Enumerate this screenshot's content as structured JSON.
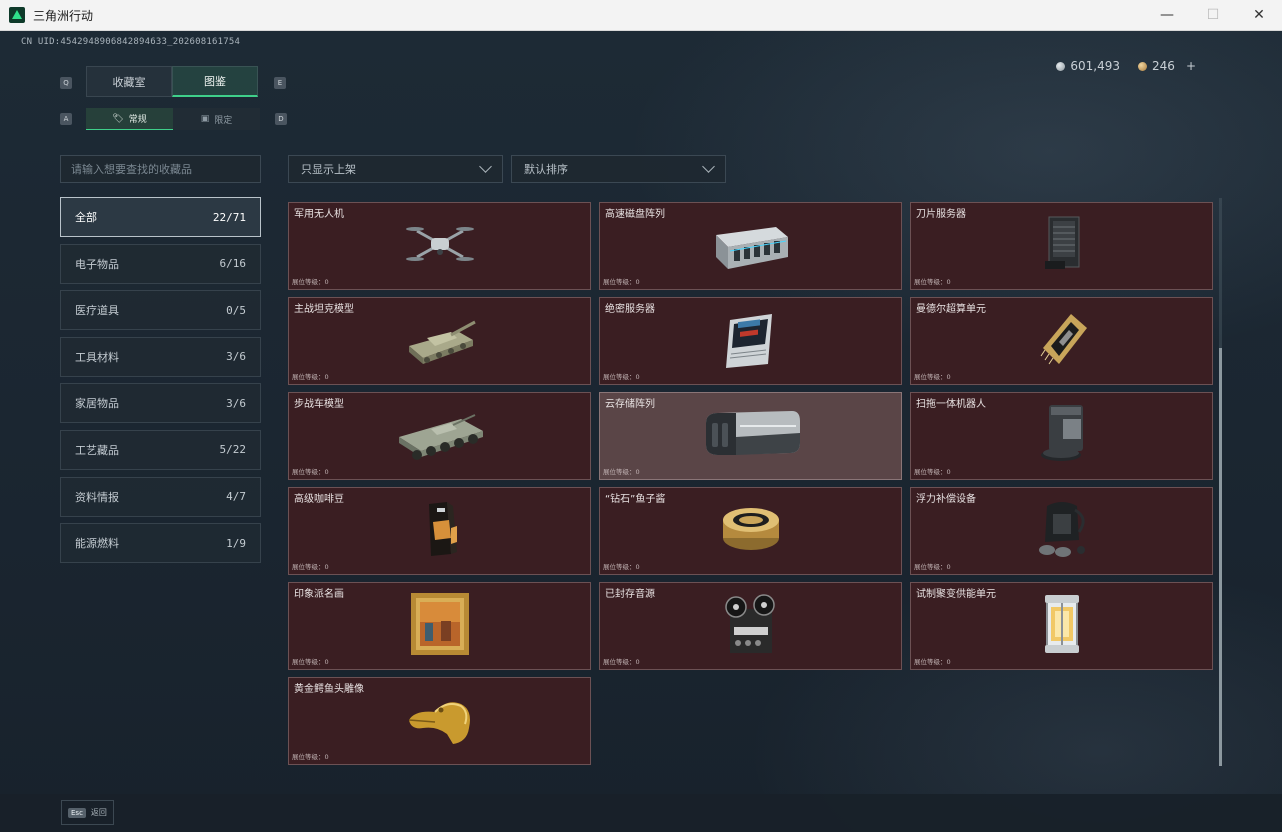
{
  "window": {
    "title": "三角洲行动",
    "minimize": "—",
    "maximize": "☐",
    "close": "✕"
  },
  "uid": "CN UID:4542948906842894633_202608161754",
  "currency": {
    "silver": "601,493",
    "gold": "246",
    "add": "+"
  },
  "keys": {
    "left": "Q",
    "right": "E",
    "sub_left": "A",
    "sub_right": "D"
  },
  "tabs": [
    "收藏室",
    "图鉴"
  ],
  "subtabs": [
    "常规",
    "限定"
  ],
  "search": {
    "placeholder": "请输入想要查找的收藏品"
  },
  "categories": [
    {
      "label": "全部",
      "count": "22/71"
    },
    {
      "label": "电子物品",
      "count": "6/16"
    },
    {
      "label": "医疗道具",
      "count": "0/5"
    },
    {
      "label": "工具材料",
      "count": "3/6"
    },
    {
      "label": "家居物品",
      "count": "3/6"
    },
    {
      "label": "工艺藏品",
      "count": "5/22"
    },
    {
      "label": "资料情报",
      "count": "4/7"
    },
    {
      "label": "能源燃料",
      "count": "1/9"
    }
  ],
  "filters": {
    "shelf": "只显示上架",
    "sort": "默认排序"
  },
  "level_text": "展位等级：0",
  "items": [
    {
      "name": "军用无人机",
      "icon": "drone-icon"
    },
    {
      "name": "高速磁盘阵列",
      "icon": "disk-array-icon"
    },
    {
      "name": "刀片服务器",
      "icon": "blade-server-icon"
    },
    {
      "name": "主战坦克模型",
      "icon": "tank-icon"
    },
    {
      "name": "绝密服务器",
      "icon": "secret-server-icon"
    },
    {
      "name": "曼德尔超算单元",
      "icon": "cpu-icon"
    },
    {
      "name": "步战车模型",
      "icon": "ifv-icon"
    },
    {
      "name": "云存储阵列",
      "icon": "cloud-storage-icon"
    },
    {
      "name": "扫拖一体机器人",
      "icon": "robot-vacuum-icon"
    },
    {
      "name": "高级咖啡豆",
      "icon": "coffee-bag-icon"
    },
    {
      "name": "“钻石”鱼子酱",
      "icon": "caviar-tin-icon"
    },
    {
      "name": "浮力补偿设备",
      "icon": "bcd-icon"
    },
    {
      "name": "印象派名画",
      "icon": "painting-icon"
    },
    {
      "name": "已封存音源",
      "icon": "reel-recorder-icon"
    },
    {
      "name": "试制聚变供能单元",
      "icon": "fusion-cell-icon"
    },
    {
      "name": "黄金鳄鱼头雕像",
      "icon": "gold-croc-icon"
    }
  ],
  "bottom": {
    "esc_key": "Esc",
    "esc_label": "返回"
  }
}
